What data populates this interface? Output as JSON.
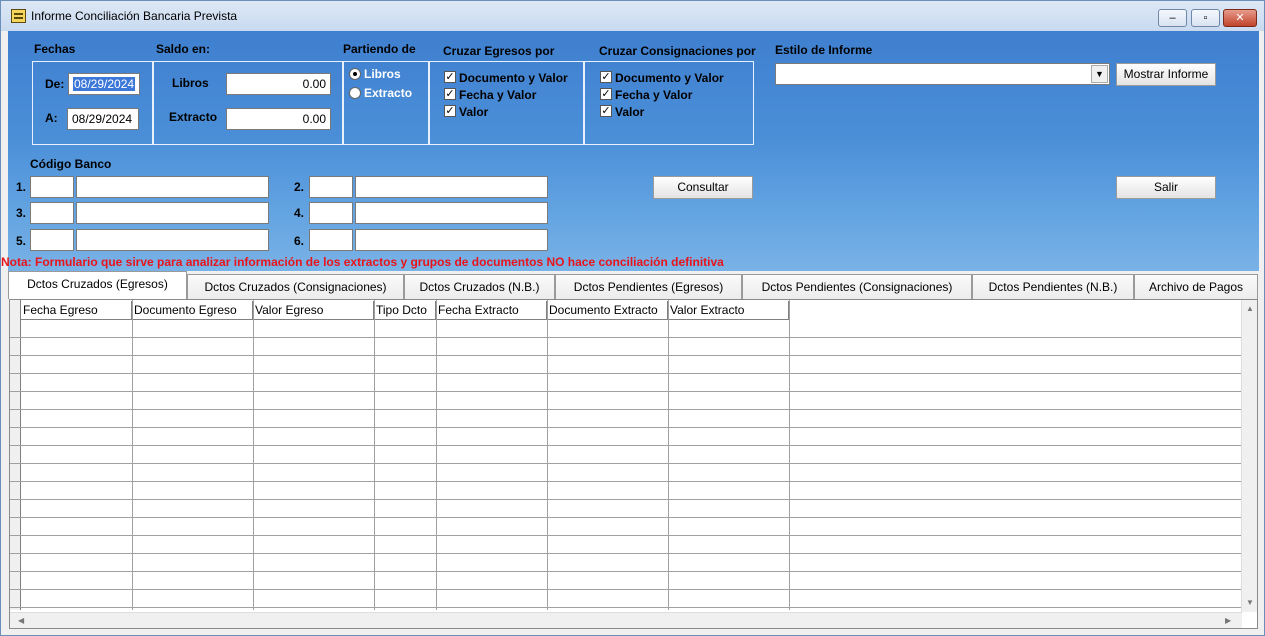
{
  "window": {
    "title": "Informe Conciliación Bancaria Prevista",
    "minimize_label": "–",
    "restore_label": "▫",
    "close_label": "✕"
  },
  "fechas": {
    "label": "Fechas",
    "de_label": "De:",
    "de_value": "08/29/2024",
    "a_label": "A:",
    "a_value": "08/29/2024"
  },
  "saldo": {
    "label": "Saldo en:",
    "libros_label": "Libros",
    "libros_value": "0.00",
    "extracto_label": "Extracto",
    "extracto_value": "0.00"
  },
  "partiendo": {
    "label": "Partiendo de",
    "opt1": "Libros",
    "opt2": "Extracto",
    "selected": "Libros"
  },
  "cruzar_egresos": {
    "label": "Cruzar Egresos por",
    "items": [
      "Documento y Valor",
      "Fecha y Valor",
      "Valor"
    ],
    "check_mark": "✓"
  },
  "cruzar_consignaciones": {
    "label": "Cruzar Consignaciones por",
    "items": [
      "Documento y Valor",
      "Fecha y Valor",
      "Valor"
    ],
    "check_mark": "✓"
  },
  "estilo": {
    "label": "Estilo de Informe",
    "value": "",
    "arrow": "▼"
  },
  "buttons": {
    "mostrar": "Mostrar Informe",
    "consultar": "Consultar",
    "salir": "Salir"
  },
  "codigo_banco": {
    "label": "Código Banco",
    "row_labels": [
      "1.",
      "2.",
      "3.",
      "4.",
      "5.",
      "6."
    ]
  },
  "note": "Nota: Formulario que sirve para analizar información de los extractos y grupos de documentos NO hace conciliación definitiva",
  "tabs": [
    "Dctos Cruzados (Egresos)",
    "Dctos Cruzados (Consignaciones)",
    "Dctos Cruzados (N.B.)",
    "Dctos Pendientes (Egresos)",
    "Dctos Pendientes (Consignaciones)",
    "Dctos Pendientes (N.B.)",
    "Archivo de Pagos"
  ],
  "active_tab": "Dctos Cruzados (Egresos)",
  "grid": {
    "columns": [
      "Fecha Egreso",
      "Documento Egreso",
      "Valor Egreso",
      "Tipo Dcto",
      "Fecha Extracto",
      "Documento Extracto",
      "Valor Extracto"
    ],
    "scroll_up": "▲",
    "scroll_down": "▼",
    "scroll_left": "◀",
    "scroll_right": "▶"
  }
}
